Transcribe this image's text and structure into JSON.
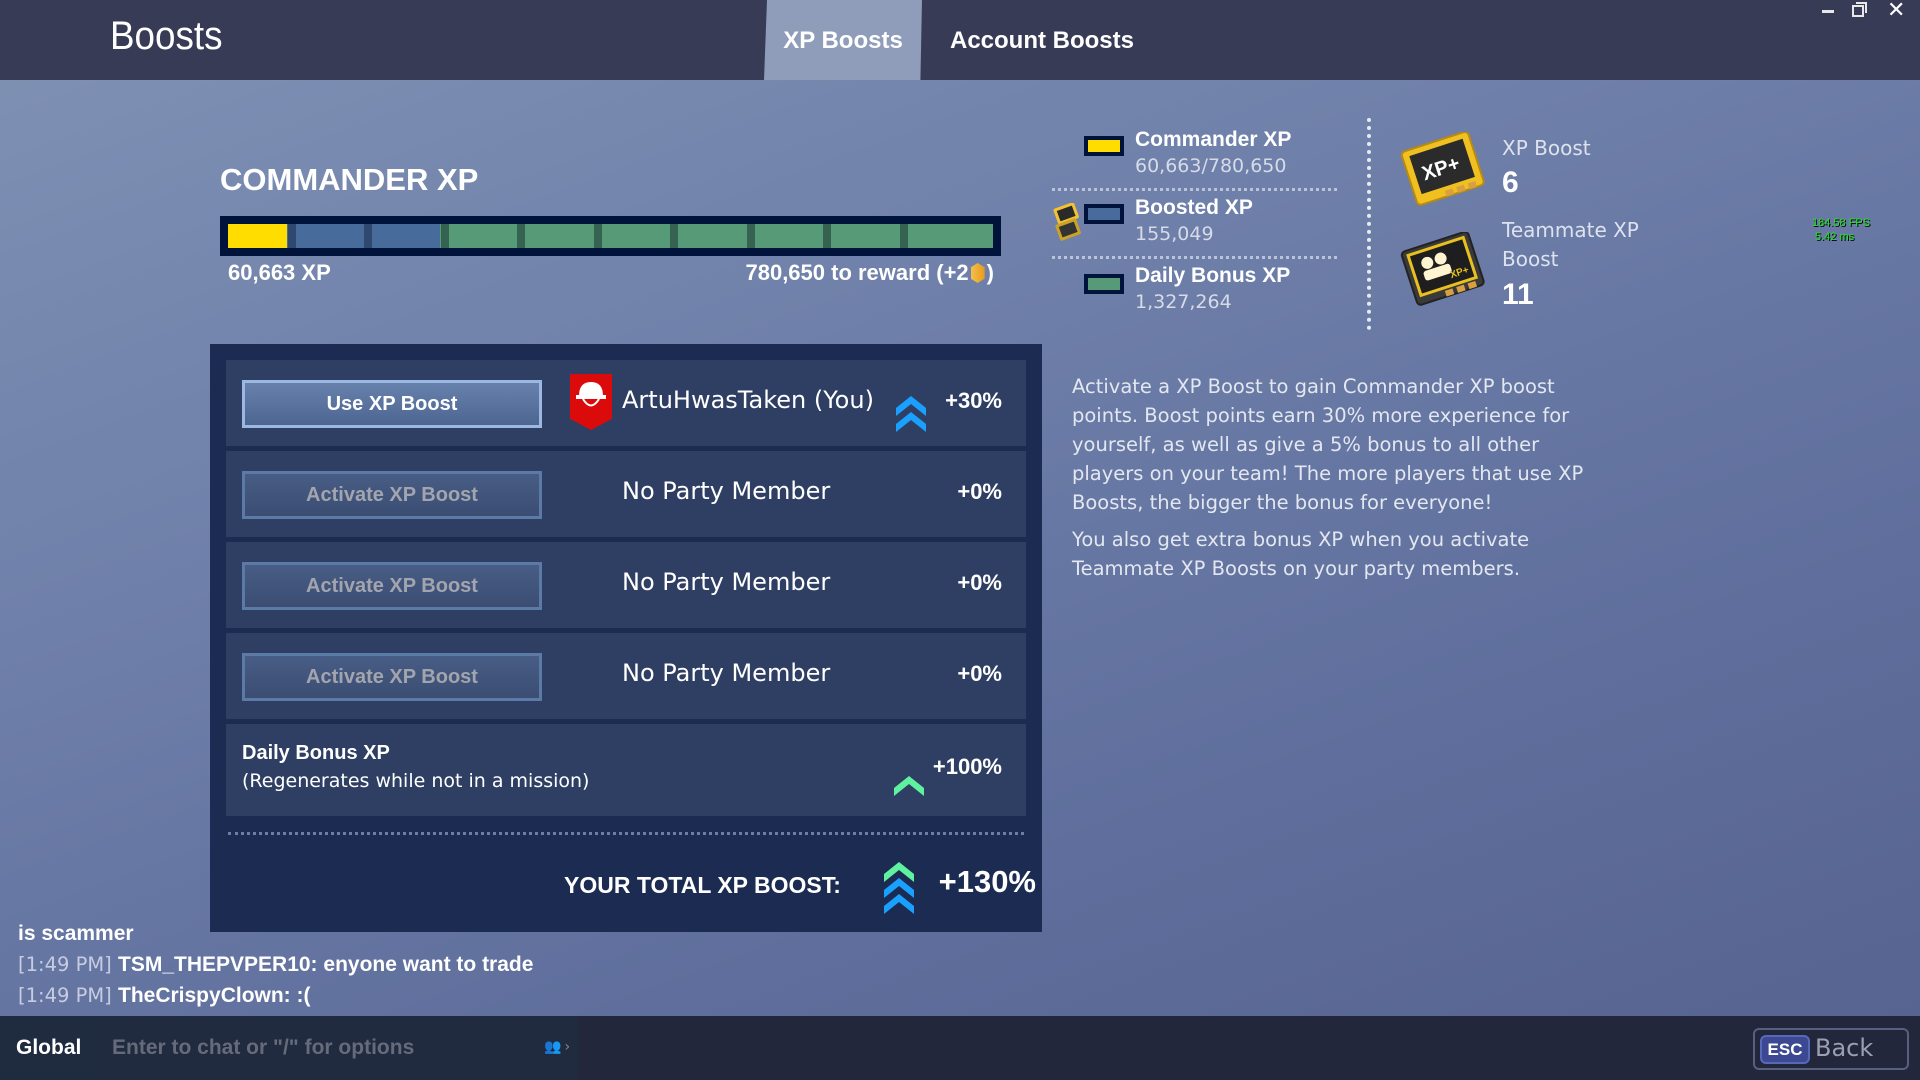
{
  "header": {
    "title": "Boosts",
    "tabs": [
      {
        "label": "XP Boosts",
        "active": true
      },
      {
        "label": "Account Boosts",
        "active": false
      }
    ],
    "window_controls": {
      "minimize": "minimize-icon",
      "restore": "restore-icon",
      "close": "✕"
    }
  },
  "commander_xp": {
    "title": "COMMANDER XP",
    "current_label": "60,663 XP",
    "reward_label_prefix": "780,650 to reward (+2",
    "reward_label_suffix": ")",
    "progress": {
      "commander_fraction": 0.0777,
      "boosted_end_fraction": 0.2777,
      "daily_end_fraction": 1.0
    },
    "bar_colors": {
      "commander": "#ffdd00",
      "boosted": "#476b9b",
      "daily": "#579a77"
    }
  },
  "legend": [
    {
      "name": "Commander XP",
      "value": "60,663/780,650",
      "color": "#ffdd00"
    },
    {
      "name": "Boosted XP",
      "value": "155,049",
      "color": "#476b9b"
    },
    {
      "name": "Daily Bonus XP",
      "value": "1,327,264",
      "color": "#579a77"
    }
  ],
  "inventory": [
    {
      "label": "XP Boost",
      "count": "6",
      "icon": "xp-boost-card-icon"
    },
    {
      "label": "Teammate XP Boost",
      "label_line1": "Teammate XP",
      "label_line2": "Boost",
      "count": "11",
      "icon": "teammate-xp-boost-card-icon"
    }
  ],
  "debug": {
    "fps": "184.58 FPS",
    "frame_time": "5.42 ms"
  },
  "party": {
    "rows": [
      {
        "button": "Use XP Boost",
        "active": true,
        "name": "ArtuHwasTaken (You)",
        "percent": "+30%"
      },
      {
        "button": "Activate XP Boost",
        "active": false,
        "name": "No Party Member",
        "percent": "+0%"
      },
      {
        "button": "Activate XP Boost",
        "active": false,
        "name": "No Party Member",
        "percent": "+0%"
      },
      {
        "button": "Activate XP Boost",
        "active": false,
        "name": "No Party Member",
        "percent": "+0%"
      }
    ],
    "daily": {
      "title": "Daily Bonus XP",
      "subtitle": "(Regenerates while not in a mission)",
      "percent": "+100%"
    },
    "total": {
      "label": "YOUR TOTAL XP BOOST:",
      "value": "+130%"
    }
  },
  "description": {
    "p1": "Activate a XP Boost to gain Commander XP boost points. Boost points earn 30% more experience for yourself, as well as give a 5% bonus to all other players on your team!  The more players that use XP Boosts, the bigger the bonus for everyone!",
    "p2": "You also get extra bonus XP when you activate Teammate XP Boosts on your party members."
  },
  "chat": {
    "messages": [
      {
        "time": "",
        "text": "is scammer"
      },
      {
        "time": "[1:49 PM]",
        "text": "TSM_THEPVPER10: enyone want to trade"
      },
      {
        "time": "[1:49 PM]",
        "text": "TheCrispyClown: :("
      }
    ],
    "channel": "Global",
    "placeholder": "Enter to chat or \"/\" for options"
  },
  "footer": {
    "esc_key": "ESC",
    "back_label": "Back"
  },
  "colors": {
    "accent_blue": "#1aa1ff",
    "accent_green": "#5ff0a0",
    "banner_red": "#dc0b0b"
  }
}
